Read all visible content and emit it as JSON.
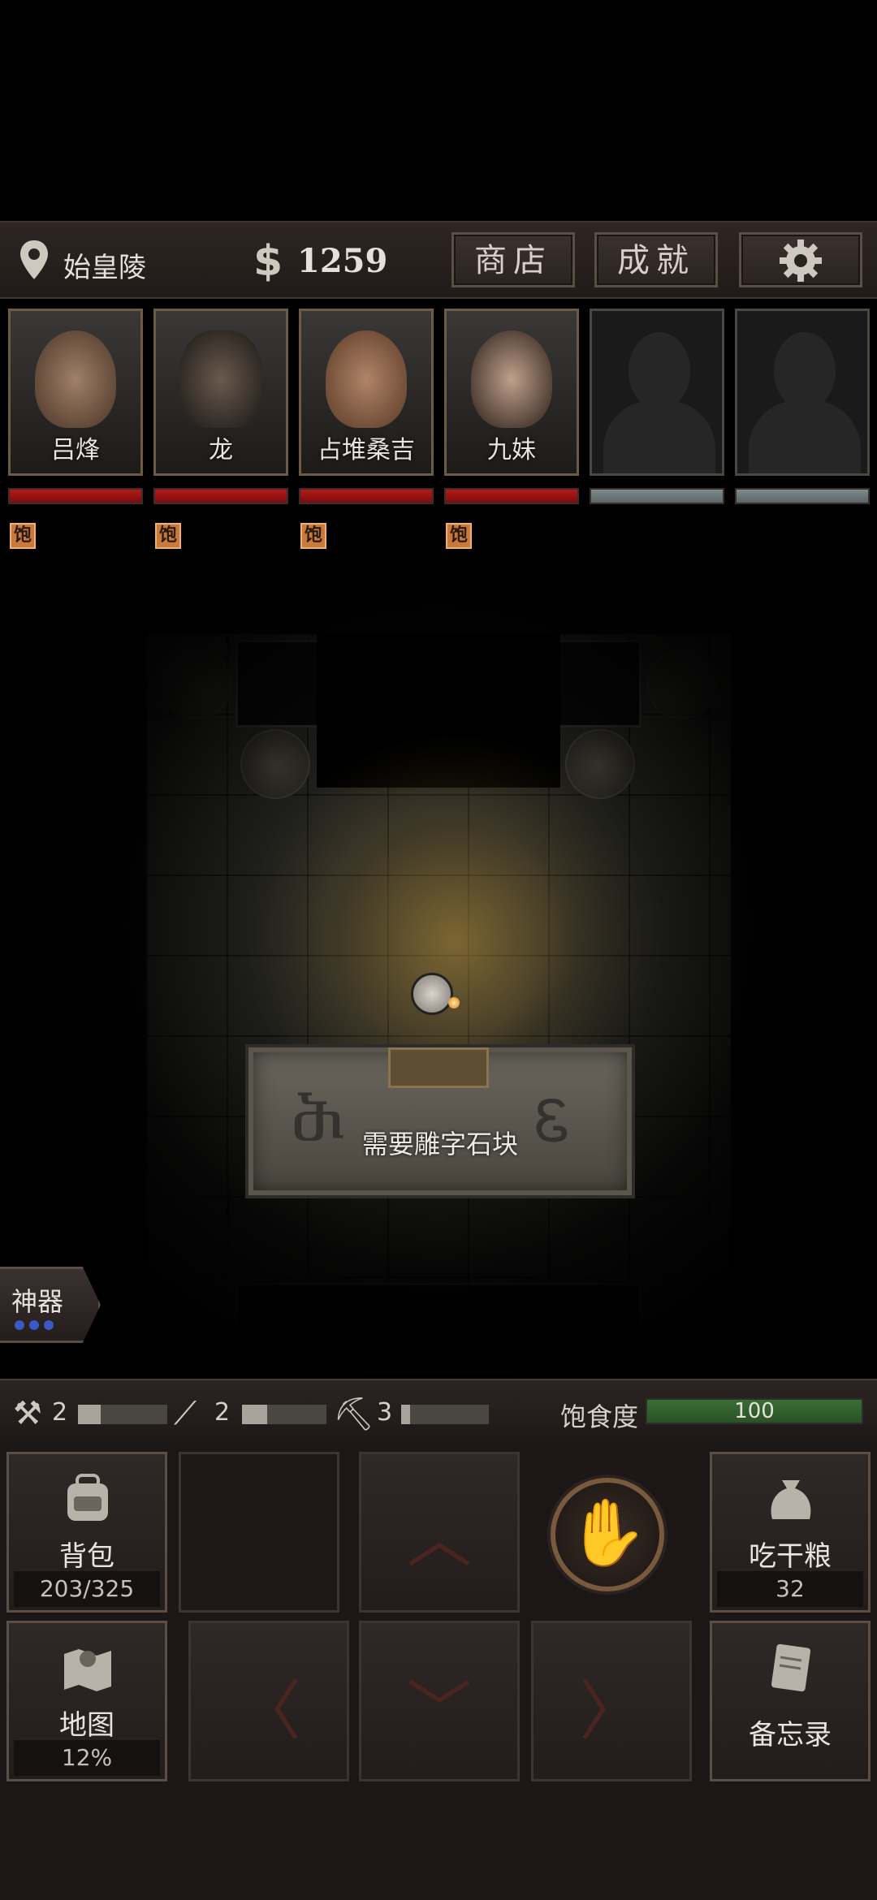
{
  "header": {
    "location": "始皇陵",
    "currency_symbol": "$",
    "money": "1259",
    "shop_label": "商店",
    "achievements_label": "成就",
    "settings_icon": "gear-icon"
  },
  "party": [
    {
      "name": "吕烽",
      "hp": 1.0,
      "status": "饱"
    },
    {
      "name": "龙",
      "hp": 1.0,
      "status": "饱"
    },
    {
      "name": "占堆桑吉",
      "hp": 1.0,
      "status": "饱"
    },
    {
      "name": "九妹",
      "hp": 1.0,
      "status": "饱"
    },
    {
      "name": "",
      "hp": 0
    },
    {
      "name": "",
      "hp": 0
    }
  ],
  "dungeon": {
    "stone_message": "需要雕字石块"
  },
  "artifact": {
    "label": "神器",
    "charges": 3
  },
  "tools": [
    {
      "icon": "torch-icon",
      "count": "2",
      "level": 0.25
    },
    {
      "icon": "rope-icon",
      "count": "2",
      "level": 0.3
    },
    {
      "icon": "shovel-icon",
      "count": "3",
      "level": 0.1
    }
  ],
  "hunger": {
    "label": "饱食度",
    "value": "100",
    "level": 1.0
  },
  "controls": {
    "backpack_label": "背包",
    "backpack_capacity": "203/325",
    "eat_label": "吃干粮",
    "eat_count": "32",
    "map_label": "地图",
    "map_progress": "12%",
    "memo_label": "备忘录",
    "interact_icon": "hand-icon"
  },
  "colors": {
    "hp_red": "#b31a1a",
    "hunger_green": "#3a6e34",
    "artifact_blue": "#3a58c8"
  }
}
